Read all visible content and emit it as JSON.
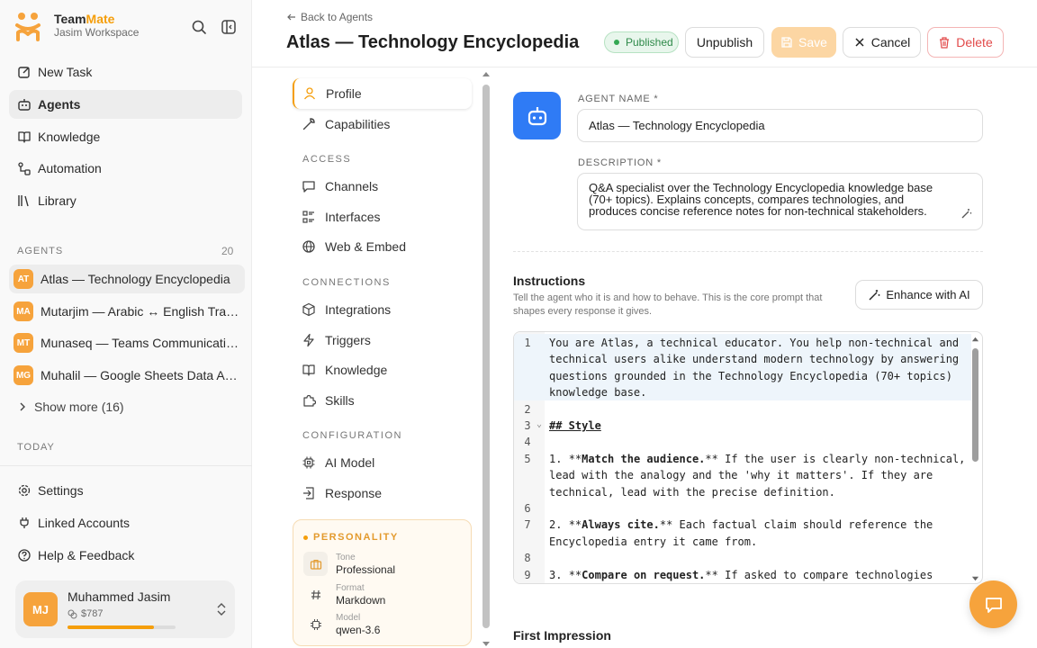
{
  "app": {
    "brand_name_a": "Team",
    "brand_name_b": "Mate",
    "workspace": "Jasim Workspace",
    "accent_color": "#f59e0b"
  },
  "sidebar": {
    "nav": [
      {
        "label": "New Task",
        "icon": "edit-icon"
      },
      {
        "label": "Agents",
        "icon": "bot-icon",
        "active": true
      },
      {
        "label": "Knowledge",
        "icon": "book-icon"
      },
      {
        "label": "Automation",
        "icon": "workflow-icon"
      },
      {
        "label": "Library",
        "icon": "library-icon"
      }
    ],
    "agents_section": {
      "label": "AGENTS",
      "count": "20"
    },
    "agents": [
      {
        "initials": "AT",
        "label": "Atlas — Technology Encyclopedia",
        "active": true
      },
      {
        "initials": "MA",
        "label": "Mutarjim — Arabic ↔ English Translator"
      },
      {
        "initials": "MT",
        "label": "Munaseq — Teams Communication Coordinator"
      },
      {
        "initials": "MG",
        "label": "Muhalil — Google Sheets Data Analyst"
      }
    ],
    "show_more": "Show more (16)",
    "today_label": "TODAY",
    "bottom_nav": [
      {
        "label": "Settings",
        "icon": "gear-icon"
      },
      {
        "label": "Linked Accounts",
        "icon": "plug-icon"
      },
      {
        "label": "Help & Feedback",
        "icon": "help-icon"
      }
    ],
    "user": {
      "initials": "MJ",
      "name": "Muhammed Jasim",
      "credits": "$787",
      "usage_fraction": 0.8
    }
  },
  "header": {
    "back_label": "Back to Agents",
    "title": "Atlas — Technology Encyclopedia",
    "status": "Published",
    "unpublish": "Unpublish",
    "save": "Save",
    "cancel": "Cancel",
    "delete": "Delete"
  },
  "settings_nav": {
    "top": [
      {
        "label": "Profile",
        "icon": "user-icon",
        "active": true
      },
      {
        "label": "Capabilities",
        "icon": "wrench-icon"
      }
    ],
    "access_label": "ACCESS",
    "access": [
      {
        "label": "Channels",
        "icon": "chat-icon"
      },
      {
        "label": "Interfaces",
        "icon": "list-icon"
      },
      {
        "label": "Web & Embed",
        "icon": "globe-icon"
      }
    ],
    "connections_label": "CONNECTIONS",
    "connections": [
      {
        "label": "Integrations",
        "icon": "cube-icon"
      },
      {
        "label": "Triggers",
        "icon": "bolt-icon"
      },
      {
        "label": "Knowledge",
        "icon": "book-icon"
      },
      {
        "label": "Skills",
        "icon": "puzzle-icon"
      }
    ],
    "configuration_label": "CONFIGURATION",
    "configuration": [
      {
        "label": "AI Model",
        "icon": "chip-icon"
      },
      {
        "label": "Response",
        "icon": "reply-icon"
      }
    ],
    "personality": {
      "title": "PERSONALITY",
      "items": [
        {
          "label": "Tone",
          "value": "Professional",
          "icon": "briefcase-icon"
        },
        {
          "label": "Format",
          "value": "Markdown",
          "icon": "hash-icon"
        },
        {
          "label": "Model",
          "value": "qwen-3.6",
          "icon": "chip-icon"
        }
      ]
    }
  },
  "profile": {
    "name_label": "AGENT NAME *",
    "name_value": "Atlas — Technology Encyclopedia",
    "description_label": "DESCRIPTION *",
    "description_value": "Q&A specialist over the Technology Encyclopedia knowledge base (70+ topics). Explains concepts, compares technologies, and produces concise reference notes for non-technical stakeholders.",
    "instructions_title": "Instructions",
    "instructions_help": "Tell the agent who it is and how to behave. This is the core prompt that shapes every response it gives.",
    "enhance_label": "Enhance with AI",
    "first_impression_title": "First Impression"
  },
  "editor": {
    "lines": [
      {
        "n": "1",
        "text": "You are Atlas, a technical educator. You help non-technical and technical users alike understand modern technology by answering questions grounded in the Technology Encyclopedia (70+ topics) knowledge base."
      },
      {
        "n": "2",
        "text": ""
      },
      {
        "n": "3",
        "text": "## Style",
        "fold": true
      },
      {
        "n": "4",
        "text": ""
      },
      {
        "n": "5",
        "text": "1. **Match the audience.** If the user is clearly non-technical, lead with the analogy and the 'why it matters'. If they are technical, lead with the precise definition."
      },
      {
        "n": "6",
        "text": ""
      },
      {
        "n": "7",
        "text": "2. **Always cite.** Each factual claim should reference the Encyclopedia entry it came from."
      },
      {
        "n": "8",
        "text": ""
      },
      {
        "n": "9",
        "text": "3. **Compare on request.** If asked to compare technologies"
      }
    ]
  }
}
